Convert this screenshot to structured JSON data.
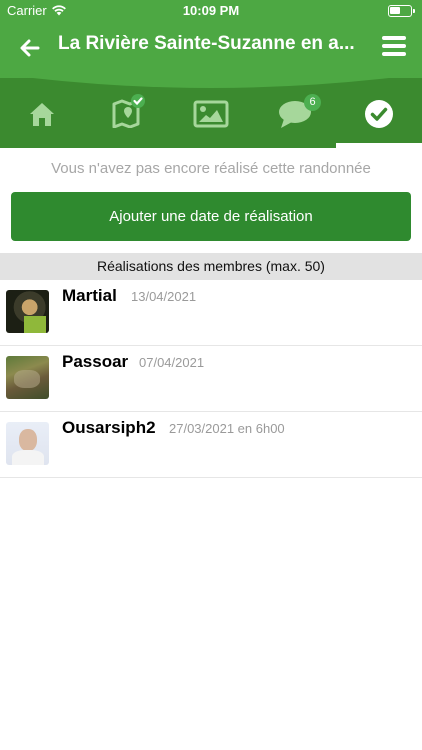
{
  "status": {
    "carrier": "Carrier",
    "time": "10:09 PM"
  },
  "header": {
    "title": "La Rivière Sainte-Suzanne en a..."
  },
  "tabs": [
    {
      "icon": "home-icon",
      "active": false
    },
    {
      "icon": "map-check-icon",
      "active": false
    },
    {
      "icon": "image-icon",
      "active": false
    },
    {
      "icon": "comments-icon",
      "badge": "6",
      "active": false
    },
    {
      "icon": "check-circle-icon",
      "active": true
    }
  ],
  "notice": "Vous n'avez pas encore réalisé cette randonnée",
  "add_button": "Ajouter une date de réalisation",
  "section_title": "Réalisations des membres (max. 50)",
  "members": [
    {
      "name": "Martial",
      "date": "13/04/2021"
    },
    {
      "name": "Passoar",
      "date": "07/04/2021"
    },
    {
      "name": "Ousarsiph2",
      "date": "27/03/2021 en 6h00"
    }
  ],
  "colors": {
    "header_green": "#4da843",
    "tab_green": "#3b8a2f",
    "button_green": "#2f8a2f"
  }
}
